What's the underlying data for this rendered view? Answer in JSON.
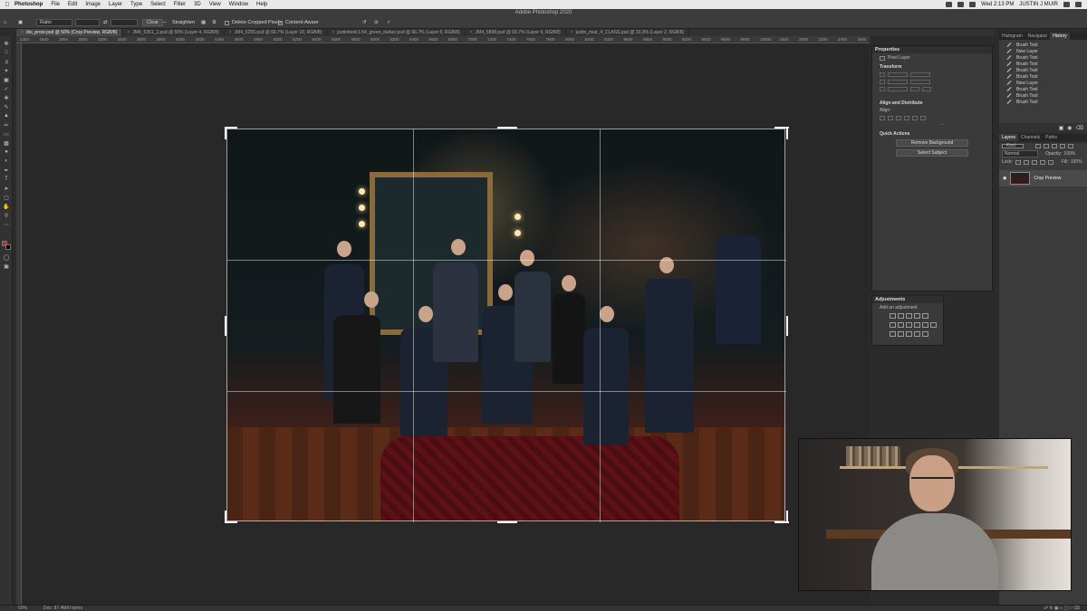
{
  "menubar": {
    "app": "Photoshop",
    "items": [
      "File",
      "Edit",
      "Image",
      "Layer",
      "Type",
      "Select",
      "Filter",
      "3D",
      "View",
      "Window",
      "Help"
    ],
    "clock": "Wed 2:13 PM",
    "user": "JUSTIN J MUIR"
  },
  "window": {
    "title": "Adobe Photoshop 2020"
  },
  "options": {
    "ratio": "Ratio",
    "clear": "Clear",
    "straighten": "Straighten",
    "delete_cropped": "Delete Cropped Pixels",
    "content_aware": "Content-Aware"
  },
  "tabs": [
    "dio_proor.psd @ 50% (Crop Preview, RGB/8)",
    "JM4_5351_2.psd @ 50% (Layer 4, RGB/8)",
    "JM4_5255.psd @ 66.7% (Layer 18, RGB/8)",
    "justinbook1-54_green_darker.psd @ 66.7% (Layer 5, RGB/8)",
    "JM4_6898.psd @ 66.7% (Layer 9, RGB/8)",
    "justin_muir_4_CLASS.psd @ 33.3% (Layer 2, RGB/8)"
  ],
  "ruler": {
    "h": [
      "2400",
      "2600",
      "2800",
      "3000",
      "3200",
      "3400",
      "3600",
      "3800",
      "4000",
      "4200",
      "4400",
      "4600",
      "4800",
      "5000",
      "5200",
      "5400",
      "5600",
      "5800",
      "6000",
      "6200",
      "6400",
      "6600",
      "6800",
      "7000",
      "7200",
      "7400",
      "7600",
      "7800",
      "8000",
      "8200",
      "8400",
      "8600",
      "8800",
      "9000",
      "9200",
      "9400",
      "9600",
      "9800",
      "10000",
      "1800",
      "2000",
      "2200",
      "2400",
      "2600"
    ]
  },
  "properties": {
    "title": "Properties",
    "kind": "Pixel Layer",
    "transform": "Transform",
    "align": "Align and Distribute",
    "align_label": "Align:",
    "quick": "Quick Actions",
    "remove_bg": "Remove Background",
    "select_subject": "Select Subject"
  },
  "adjustments": {
    "title": "Adjustments",
    "add": "Add an adjustment"
  },
  "right_tabs": [
    "Histogram",
    "Navigator",
    "History"
  ],
  "history": [
    "Brush Tool",
    "New Layer",
    "Brush Tool",
    "Brush Tool",
    "Brush Tool",
    "Brush Tool",
    "New Layer",
    "Brush Tool",
    "Brush Tool",
    "Brush Tool"
  ],
  "layers_tabs": [
    "Layers",
    "Channels",
    "Paths"
  ],
  "layers": {
    "kind": "Kind",
    "blend": "Normal",
    "opacity_label": "Opacity:",
    "opacity": "100%",
    "lock_label": "Lock:",
    "fill_label": "Fill:",
    "fill": "100%",
    "items": [
      {
        "name": "Crop Preview"
      }
    ]
  },
  "status": {
    "zoom": "50%",
    "doc": "Doc: 87.4M/0 bytes"
  },
  "colors": {
    "fg": "#d8241f",
    "bg": "#000000",
    "accent": "#ffffff"
  }
}
